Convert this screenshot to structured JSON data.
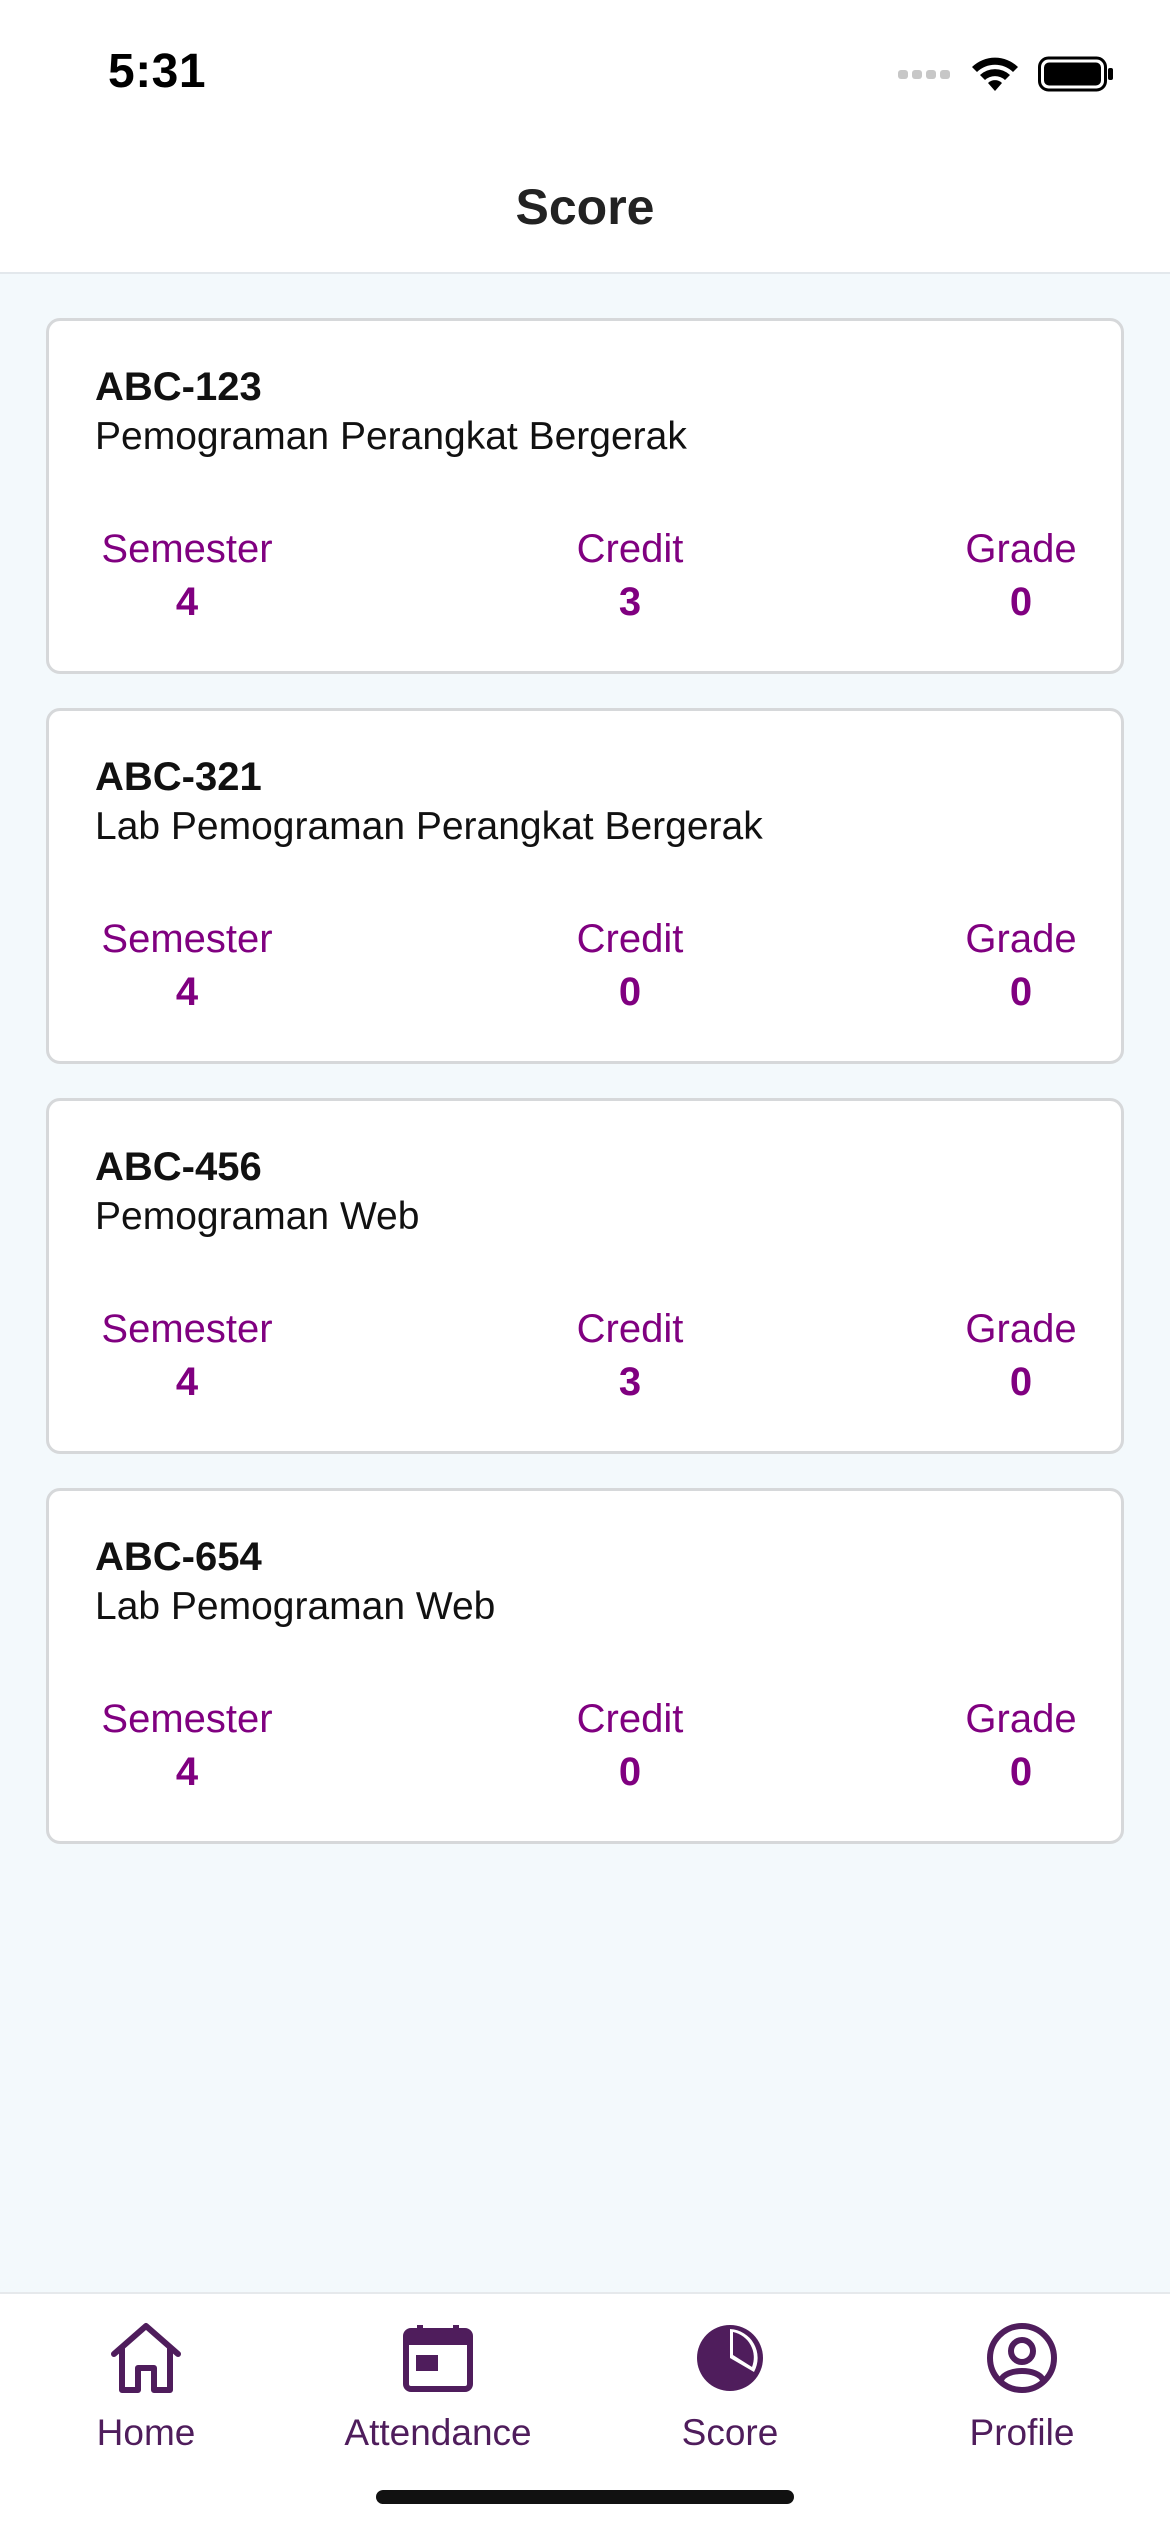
{
  "status": {
    "time": "5:31"
  },
  "header": {
    "title": "Score"
  },
  "courses": [
    {
      "code": "ABC-123",
      "name": "Pemograman Perangkat Bergerak",
      "semester_label": "Semester",
      "semester": "4",
      "credit_label": "Credit",
      "credit": "3",
      "grade_label": "Grade",
      "grade": "0"
    },
    {
      "code": "ABC-321",
      "name": "Lab Pemograman Perangkat Bergerak",
      "semester_label": "Semester",
      "semester": "4",
      "credit_label": "Credit",
      "credit": "0",
      "grade_label": "Grade",
      "grade": "0"
    },
    {
      "code": "ABC-456",
      "name": "Pemograman Web",
      "semester_label": "Semester",
      "semester": "4",
      "credit_label": "Credit",
      "credit": "3",
      "grade_label": "Grade",
      "grade": "0"
    },
    {
      "code": "ABC-654",
      "name": "Lab Pemograman Web",
      "semester_label": "Semester",
      "semester": "4",
      "credit_label": "Credit",
      "credit": "0",
      "grade_label": "Grade",
      "grade": "0"
    }
  ],
  "tabs": [
    {
      "label": "Home",
      "icon": "home-icon"
    },
    {
      "label": "Attendance",
      "icon": "calendar-icon"
    },
    {
      "label": "Score",
      "icon": "pie-chart-icon",
      "active": true
    },
    {
      "label": "Profile",
      "icon": "user-circle-icon"
    }
  ],
  "colors": {
    "accent": "#800080",
    "tab_icon": "#4f1d5c",
    "background": "#f3f9fc"
  }
}
